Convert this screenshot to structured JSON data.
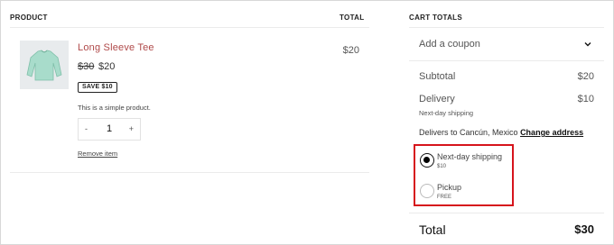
{
  "table": {
    "header_product": "PRODUCT",
    "header_total": "TOTAL"
  },
  "item": {
    "name": "Long Sleeve Tee",
    "original_price": "$30",
    "price": "$20",
    "badge": "SAVE $10",
    "description": "This is a simple product.",
    "quantity": "1",
    "minus": "-",
    "plus": "+",
    "remove": "Remove item",
    "line_total": "$20",
    "image": "long-sleeve-tee-image"
  },
  "totals": {
    "header": "CART TOTALS",
    "coupon": "Add a coupon",
    "subtotal_label": "Subtotal",
    "subtotal_value": "$20",
    "delivery_label": "Delivery",
    "delivery_value": "$10",
    "delivery_method": "Next-day shipping",
    "delivers_prefix": "Delivers to Cancún, Mexico",
    "change_address": "Change address",
    "shipping_options": [
      {
        "name": "Next-day shipping",
        "price": "$10",
        "selected": true
      },
      {
        "name": "Pickup",
        "price": "FREE",
        "selected": false
      }
    ],
    "total_label": "Total",
    "total_value": "$30"
  },
  "colors": {
    "product_link": "#b04a4a",
    "highlight_border": "#d6141c",
    "shirt": "#a8dccb"
  }
}
